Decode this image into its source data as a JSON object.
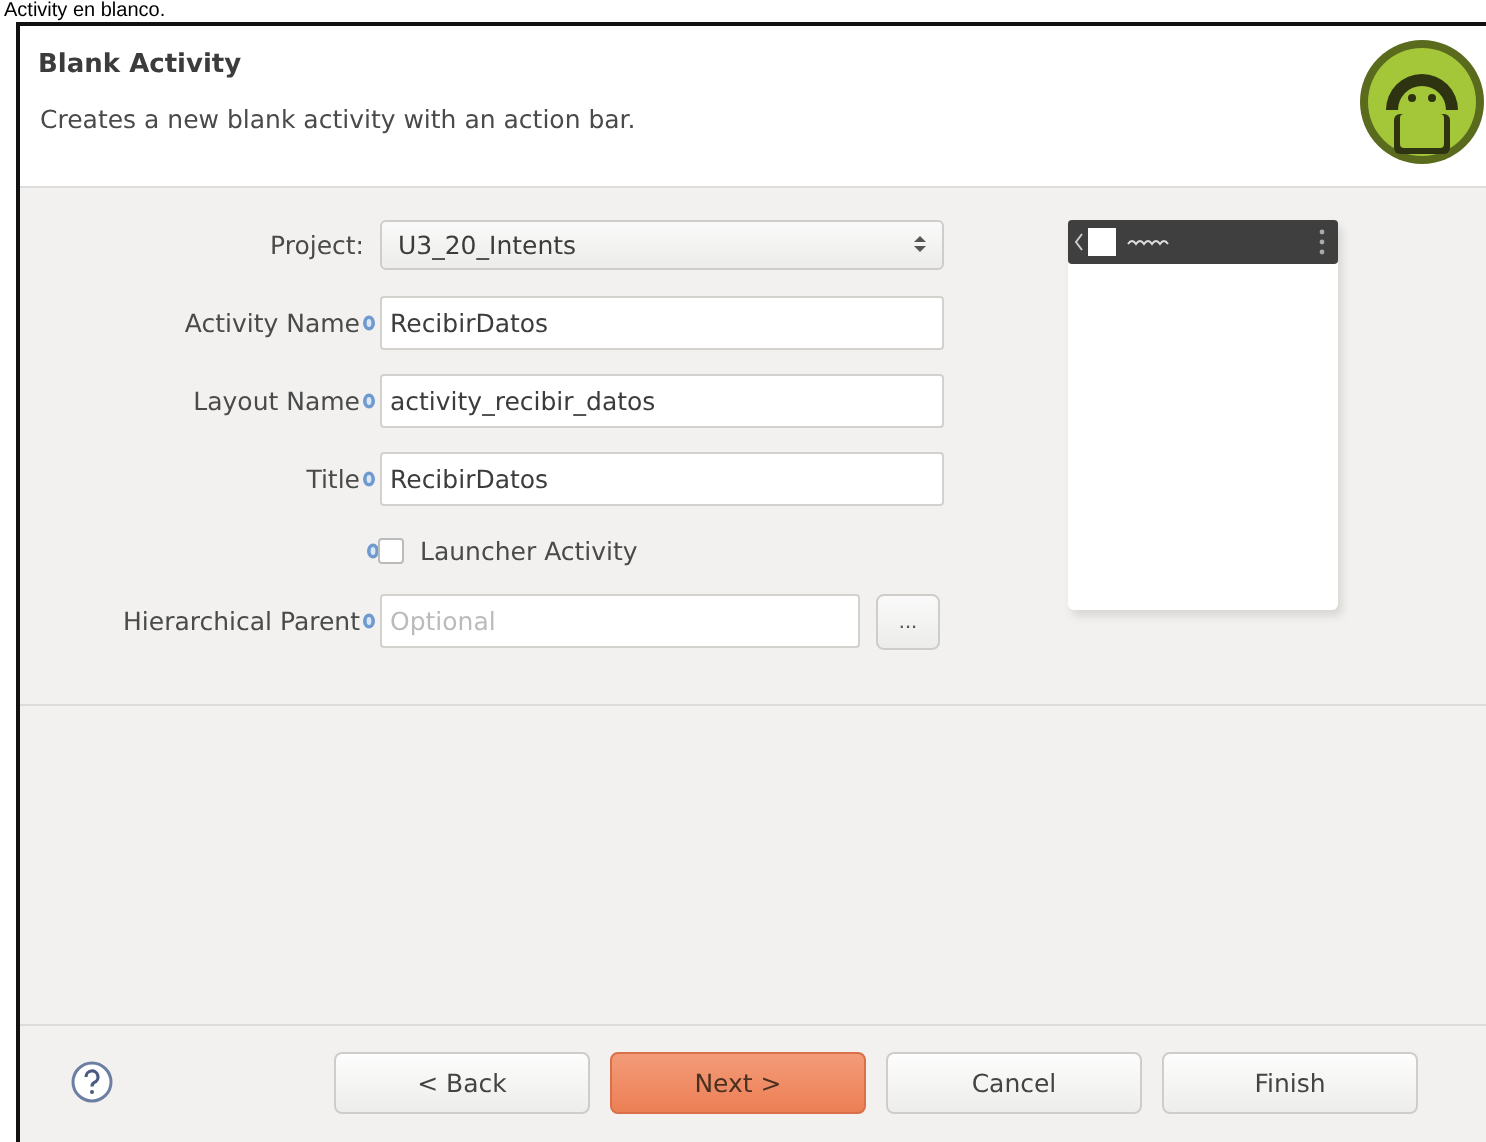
{
  "caption": "Activity en blanco.",
  "header": {
    "title": "Blank Activity",
    "description": "Creates a new blank activity with an action bar."
  },
  "fields": [
    {
      "kind": "dropdown",
      "label": "Project:",
      "value": "U3_20_Intents",
      "info": false
    },
    {
      "kind": "text",
      "label": "Activity Name",
      "value": "RecibirDatos",
      "info": true
    },
    {
      "kind": "text",
      "label": "Layout Name",
      "value": "activity_recibir_datos",
      "info": true
    },
    {
      "kind": "text",
      "label": "Title",
      "value": "RecibirDatos",
      "info": true
    },
    {
      "kind": "checkbox",
      "label": "Launcher Activity",
      "checked": false,
      "info": true
    },
    {
      "kind": "browse",
      "label": "Hierarchical Parent",
      "placeholder": "Optional",
      "button": "...",
      "info": true
    }
  ],
  "buttons": [
    {
      "label": "< Back",
      "primary": false
    },
    {
      "label": "Next >",
      "primary": true
    },
    {
      "label": "Cancel",
      "primary": false
    },
    {
      "label": "Finish",
      "primary": false
    }
  ]
}
